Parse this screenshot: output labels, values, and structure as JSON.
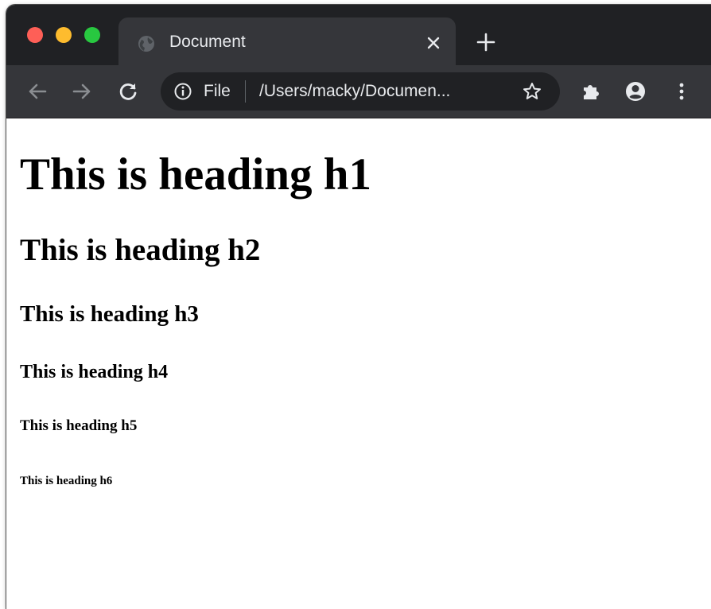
{
  "browser": {
    "tab": {
      "title": "Document",
      "favicon_icon": "globe-icon",
      "close_icon": "close-icon"
    },
    "new_tab_icon": "plus-icon",
    "window_controls": {
      "close_color": "#fe5f57",
      "minimize_color": "#febc2e",
      "zoom_color": "#28c840"
    },
    "toolbar": {
      "back_icon": "arrow-left-icon",
      "forward_icon": "arrow-right-icon",
      "reload_icon": "reload-icon",
      "extensions_icon": "puzzle-icon",
      "profile_icon": "account-icon",
      "menu_icon": "kebab-menu-icon"
    },
    "omnibox": {
      "info_icon": "info-icon",
      "scheme_label": "File",
      "url": "/Users/macky/Documen...",
      "bookmark_icon": "star-icon"
    },
    "colors": {
      "frame": "#202124",
      "toolbar": "#35363a",
      "text": "#e8eaed"
    }
  },
  "page": {
    "headings": {
      "h1": "This is heading h1",
      "h2": "This is heading h2",
      "h3": "This is heading h3",
      "h4": "This is heading h4",
      "h5": "This is heading h5",
      "h6": "This is heading h6"
    }
  }
}
